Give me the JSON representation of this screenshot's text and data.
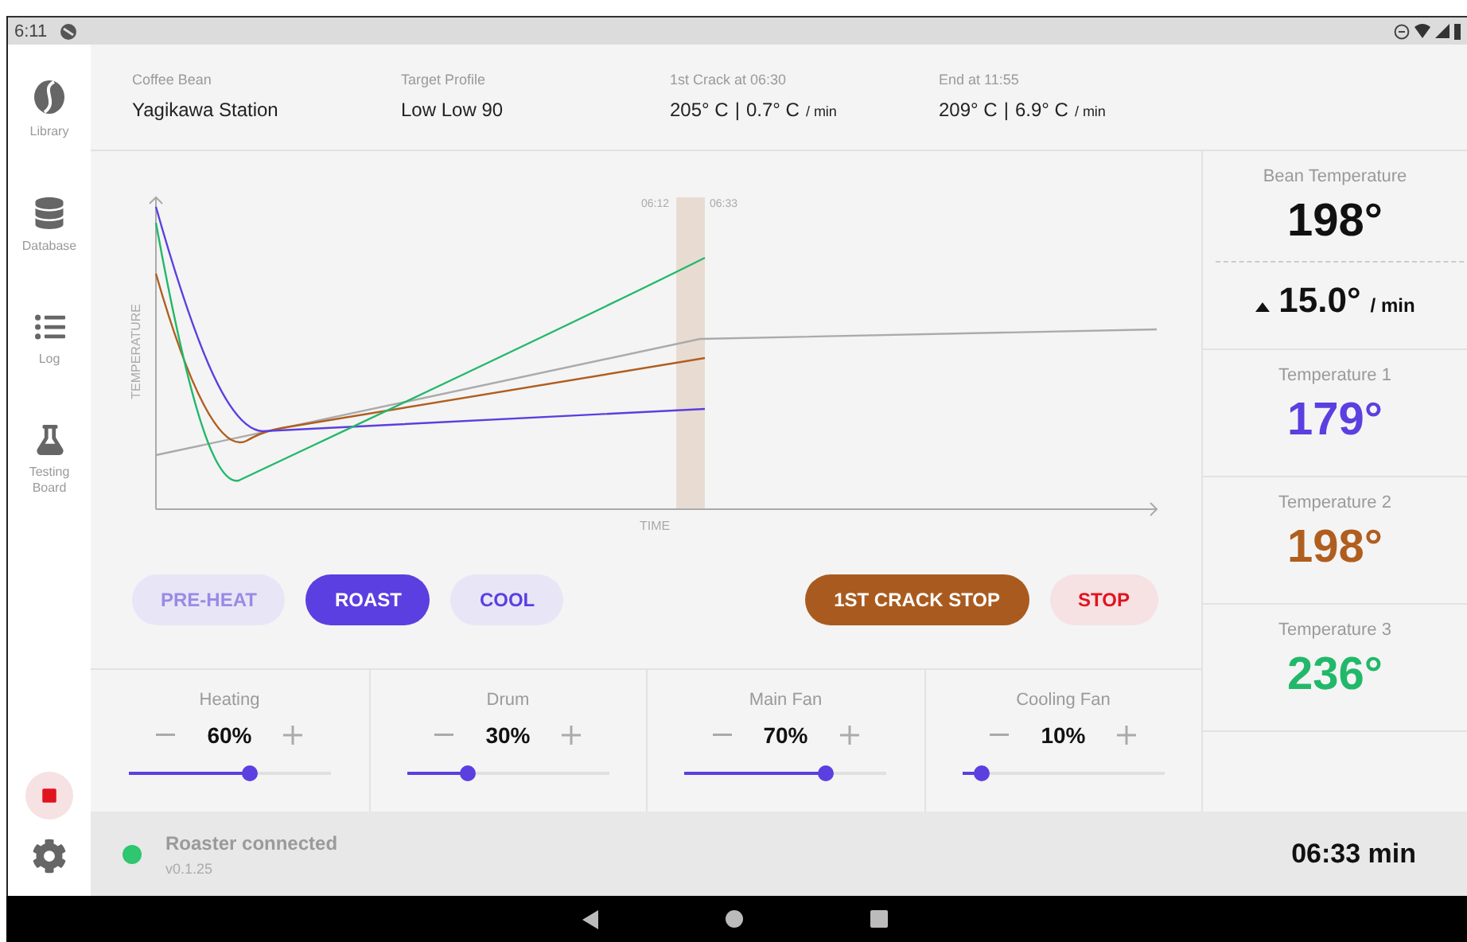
{
  "status_bar": {
    "time": "6:11"
  },
  "sidebar": {
    "items": [
      {
        "label": "Library"
      },
      {
        "label": "Database"
      },
      {
        "label": "Log"
      },
      {
        "label": "Testing Board"
      }
    ]
  },
  "header": {
    "fields": [
      {
        "kind": "text",
        "label": "Coffee Bean",
        "value": "Yagikawa Station"
      },
      {
        "kind": "text",
        "label": "Target Profile",
        "value": "Low Low 90"
      },
      {
        "kind": "reading",
        "label": "1st Crack at 06:30",
        "temperature": "205° C",
        "separator": "|",
        "rate": "0.7° C",
        "rate_unit": "/ min"
      },
      {
        "kind": "reading",
        "label": "End at 11:55",
        "temperature": "209° C",
        "separator": "|",
        "rate": "6.9° C",
        "rate_unit": "/ min"
      }
    ]
  },
  "chart": {
    "ylabel": "TEMPERATURE",
    "xlabel": "TIME",
    "marker_start": "06:12",
    "marker_end": "06:33"
  },
  "modes": [
    {
      "label": "PRE-HEAT",
      "selected": false,
      "disabled": true
    },
    {
      "label": "ROAST",
      "selected": true,
      "disabled": false
    },
    {
      "label": "COOL",
      "selected": false,
      "disabled": false
    }
  ],
  "actions": [
    {
      "kind": "crack",
      "label": "1ST CRACK STOP"
    },
    {
      "kind": "stop",
      "label": "STOP"
    }
  ],
  "controls": [
    {
      "label": "Heating",
      "value": "60%",
      "level": 0.6
    },
    {
      "label": "Drum",
      "value": "30%",
      "level": 0.3
    },
    {
      "label": "Main Fan",
      "value": "70%",
      "level": 0.7
    },
    {
      "label": "Cooling Fan",
      "value": "10%",
      "level": 0.1
    }
  ],
  "readings": {
    "bean": {
      "label": "Bean Temperature",
      "value": "198°",
      "rate": "15.0°",
      "rate_unit": "/ min"
    },
    "sensors": [
      {
        "label": "Temperature 1",
        "value": "179°",
        "color": "#5b3fe0"
      },
      {
        "label": "Temperature 2",
        "value": "198°",
        "color": "#b05e1f"
      },
      {
        "label": "Temperature 3",
        "value": "236°",
        "color": "#22b86a"
      }
    ]
  },
  "footer": {
    "status": "Roaster connected",
    "version": "v0.1.25",
    "color": "#2ec66f",
    "elapsed": "06:33 min"
  }
}
